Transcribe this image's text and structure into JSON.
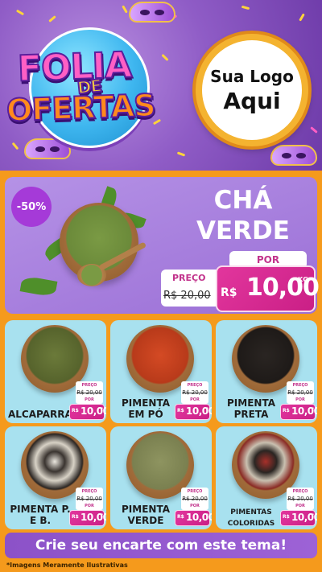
{
  "header": {
    "title_line1": "FOLIA",
    "title_line2": "DE",
    "title_line3": "OFERTAS",
    "logo_line1": "Sua Logo",
    "logo_line2": "Aqui"
  },
  "featured": {
    "discount": "-50%",
    "name_line1": "CHÁ",
    "name_line2": "VERDE",
    "old_label": "PREÇO",
    "old_price": "R$ 20,00",
    "new_label": "POR",
    "currency": "R$",
    "new_price": "10,00",
    "unit": "KG"
  },
  "products": [
    {
      "name": "ALCAPARRAS",
      "old_label": "PREÇO",
      "old_price": "R$ 20,00",
      "new_label": "POR",
      "currency": "R$",
      "new_price": "10,00",
      "unit": "KG"
    },
    {
      "name": "PIMENTA EM PÓ",
      "old_label": "PREÇO",
      "old_price": "R$ 20,00",
      "new_label": "POR",
      "currency": "R$",
      "new_price": "10,00",
      "unit": "KG"
    },
    {
      "name": "PIMENTA PRETA",
      "old_label": "PREÇO",
      "old_price": "R$ 20,00",
      "new_label": "POR",
      "currency": "R$",
      "new_price": "10,00",
      "unit": "KG"
    },
    {
      "name": "PIMENTA P. E B.",
      "old_label": "PREÇO",
      "old_price": "R$ 20,00",
      "new_label": "POR",
      "currency": "R$",
      "new_price": "10,00",
      "unit": "KG"
    },
    {
      "name": "PIMENTA VERDE",
      "old_label": "PREÇO",
      "old_price": "R$ 20,00",
      "new_label": "POR",
      "currency": "R$",
      "new_price": "10,00",
      "unit": "KG"
    },
    {
      "name": "PIMENTAS COLORIDAS",
      "old_label": "PREÇO",
      "old_price": "R$ 20,00",
      "new_label": "POR",
      "currency": "R$",
      "new_price": "10,00",
      "unit": "KG"
    }
  ],
  "cta": "Crie seu encarte com este tema!",
  "disclaimer": "*Imagens Meramente Ilustrativas",
  "colors": {
    "header_purple": "#8f5cc6",
    "orange_background": "#f59a1c",
    "card_blue": "#a8e1ef",
    "price_pink": "#d92b92",
    "logo_gold": "#f4b330",
    "cta_purple": "#8c52c8"
  }
}
